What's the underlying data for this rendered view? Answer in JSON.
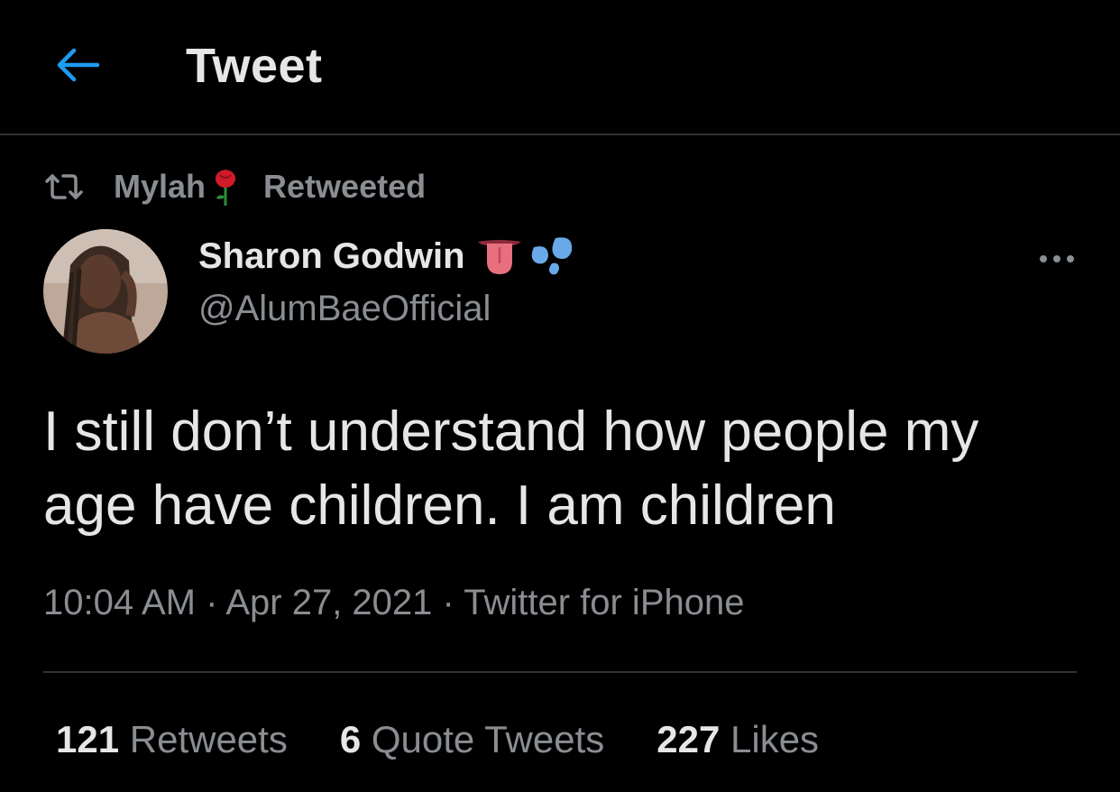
{
  "header": {
    "title": "Tweet",
    "back_icon": "arrow-left-icon"
  },
  "retweet_context": {
    "icon": "retweet-icon",
    "name": "Mylah",
    "emoji": "rose-icon",
    "label": "Retweeted"
  },
  "tweet": {
    "author_name": "Sharon Godwin",
    "author_emojis": [
      "tongue-icon",
      "sweat-droplets-icon"
    ],
    "handle": "@AlumBaeOfficial",
    "text": "I still don’t understand how people my age have children. I am children",
    "meta": "10:04 AM · Apr 27, 2021 · Twitter for iPhone",
    "more_icon": "more-dots-icon"
  },
  "stats": {
    "retweets_count": "121",
    "retweets_label": "Retweets",
    "quotes_count": "6",
    "quotes_label": "Quote Tweets",
    "likes_count": "227",
    "likes_label": "Likes"
  },
  "colors": {
    "background": "#000000",
    "accent": "#1d9bf0",
    "text_primary": "#e6e6e6",
    "text_secondary": "#8a8d91",
    "divider": "#2f3336"
  }
}
